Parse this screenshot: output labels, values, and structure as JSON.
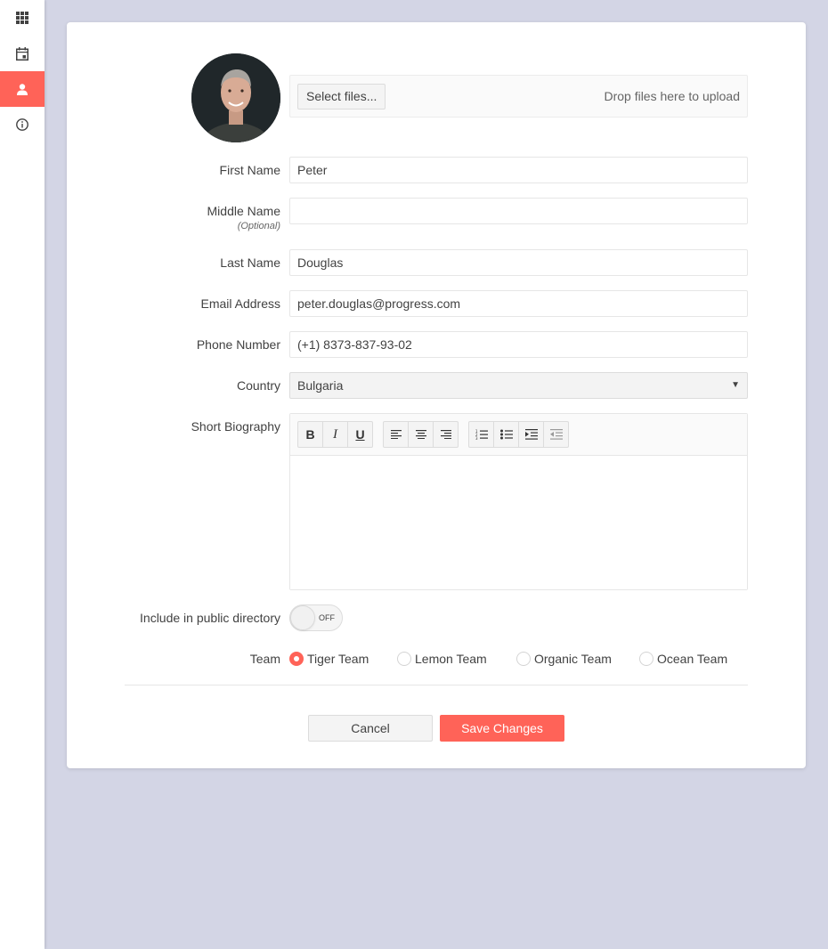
{
  "sidebar": {
    "items": [
      {
        "icon": "grid-icon",
        "active": false
      },
      {
        "icon": "calendar-icon",
        "active": false
      },
      {
        "icon": "user-icon",
        "active": true
      },
      {
        "icon": "info-icon",
        "active": false
      }
    ]
  },
  "upload": {
    "select_label": "Select files...",
    "drop_hint": "Drop files here to upload"
  },
  "form": {
    "first_name": {
      "label": "First Name",
      "value": "Peter"
    },
    "middle_name": {
      "label": "Middle Name",
      "hint": "(Optional)",
      "value": ""
    },
    "last_name": {
      "label": "Last Name",
      "value": "Douglas"
    },
    "email": {
      "label": "Email Address",
      "value": "peter.douglas@progress.com"
    },
    "phone": {
      "label": "Phone Number",
      "value": "(+1) 8373-837-93-02"
    },
    "country": {
      "label": "Country",
      "value": "Bulgaria"
    },
    "bio": {
      "label": "Short Biography",
      "toolbar": {
        "bold": "B",
        "italic": "I",
        "underline": "U",
        "icons": [
          "bold-icon",
          "italic-icon",
          "underline-icon",
          "align-left-icon",
          "align-center-icon",
          "align-right-icon",
          "ordered-list-icon",
          "unordered-list-icon",
          "indent-icon",
          "outdent-icon"
        ]
      },
      "value": ""
    },
    "public_directory": {
      "label": "Include in public directory",
      "state": "OFF"
    },
    "team": {
      "label": "Team",
      "selected": "Tiger Team",
      "options": [
        "Tiger Team",
        "Lemon Team",
        "Organic Team",
        "Ocean Team"
      ]
    }
  },
  "actions": {
    "cancel": "Cancel",
    "save": "Save Changes"
  },
  "colors": {
    "accent": "#ff6358",
    "background": "#d3d5e5",
    "card": "#ffffff"
  }
}
